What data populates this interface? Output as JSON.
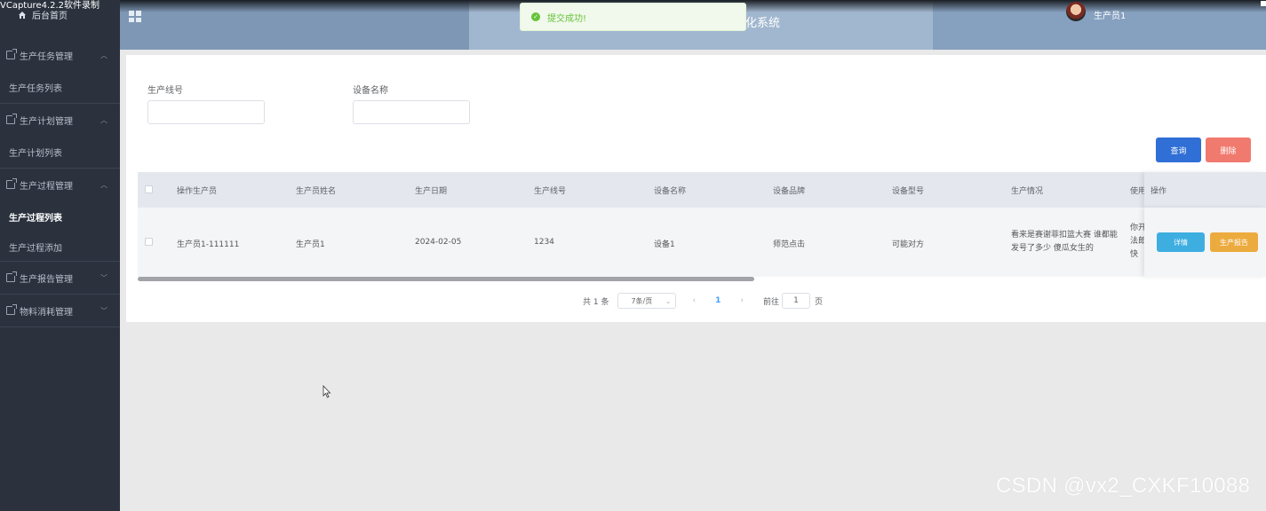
{
  "recorder_title": "VCapture4.2.2软件录制",
  "sidebar": {
    "home_label": "后台首页",
    "groups": [
      {
        "label": "生产任务管理",
        "items": [
          "生产任务列表"
        ]
      },
      {
        "label": "生产计划管理",
        "items": [
          "生产计划列表"
        ]
      },
      {
        "label": "生产过程管理",
        "items": [
          "生产过程列表",
          "生产过程添加"
        ],
        "active_item": "生产过程列表"
      },
      {
        "label": "生产报告管理",
        "items": []
      },
      {
        "label": "物料消耗管理",
        "items": []
      }
    ]
  },
  "topbar": {
    "system_title": "化系统",
    "user_name": "生产员1"
  },
  "toast": {
    "message": "提交成功!",
    "type": "success"
  },
  "search": {
    "line_label": "生产线号",
    "line_value": "",
    "device_label": "设备名称",
    "device_value": "",
    "query_button": "查询",
    "delete_button": "删除"
  },
  "table": {
    "columns": [
      "操作生产员",
      "生产员姓名",
      "生产日期",
      "生产线号",
      "设备名称",
      "设备品牌",
      "设备型号",
      "生产情况",
      "使用",
      "操作"
    ],
    "rows": [
      {
        "operator": "生产员1-111111",
        "name": "生产员1",
        "date": "2024-02-05",
        "line": "1234",
        "device": "设备1",
        "brand": "师范点击",
        "model": "可能对方",
        "situation": "看来是赛谢菲扣篮大赛 谁都能发号了多少 傻瓜女生的",
        "usage": "你开法郎快",
        "detail_button": "详情",
        "report_button": "生产报告"
      }
    ]
  },
  "pagination": {
    "total_text": "共 1 条",
    "page_size": "7条/页",
    "current_page": "1",
    "goto_label": "前往",
    "goto_value": "1",
    "page_suffix": "页"
  },
  "watermark": "CSDN @vx2_CXKF10088",
  "colors": {
    "sidebar_bg": "#2b323e",
    "topbar_bg": "#7e97b5",
    "query_button": "#2f6fd6",
    "delete_button": "#f07a6e",
    "detail_button": "#3eaee0",
    "report_button": "#ecab3e",
    "toast_success": "#67c23a"
  }
}
